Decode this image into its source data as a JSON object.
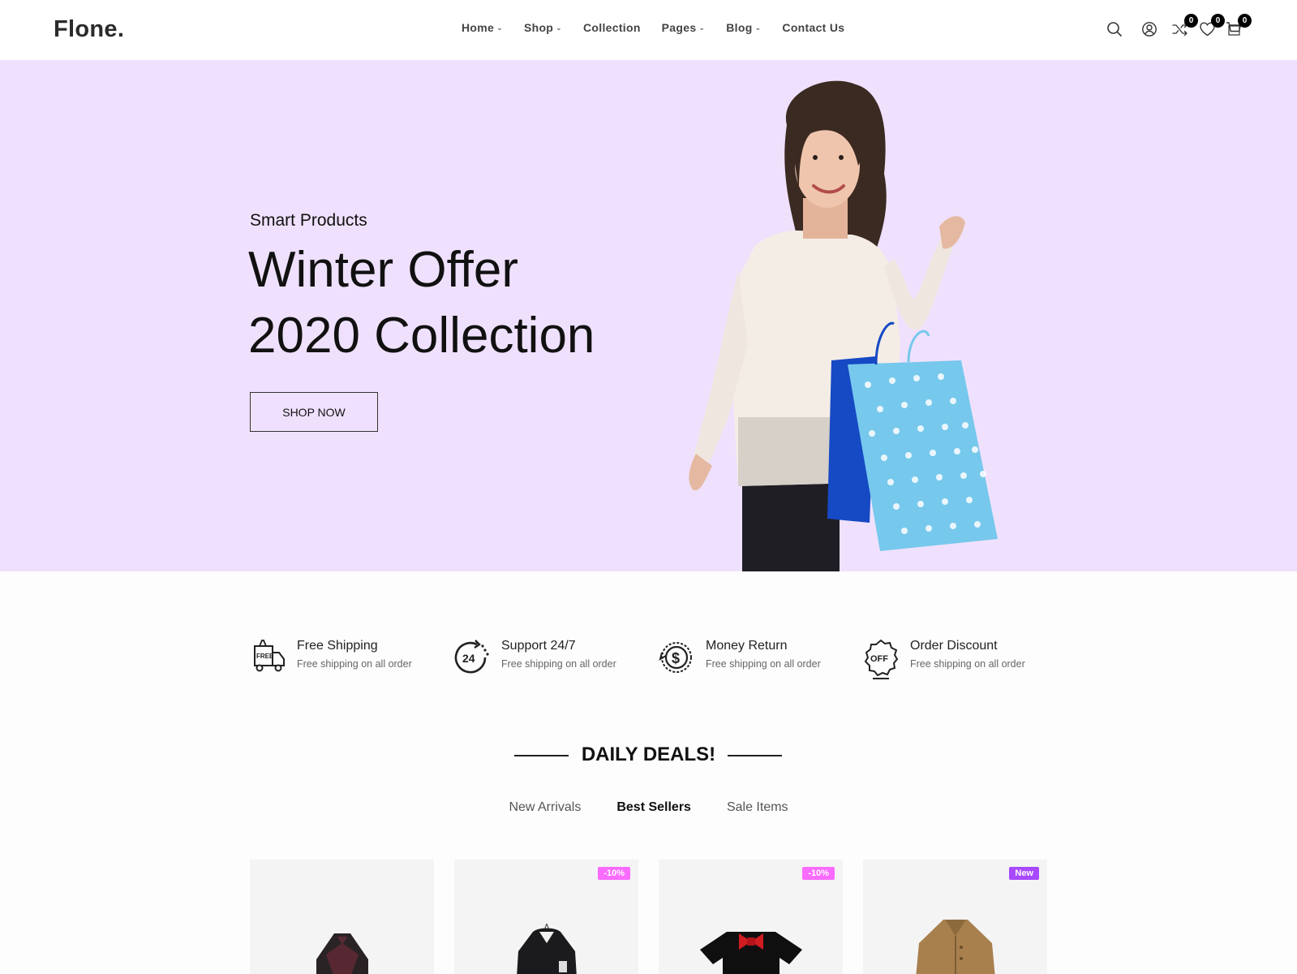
{
  "header": {
    "logo": "Flone.",
    "nav": [
      {
        "label": "Home",
        "has_dropdown": true
      },
      {
        "label": "Shop",
        "has_dropdown": true
      },
      {
        "label": "Collection",
        "has_dropdown": false
      },
      {
        "label": "Pages",
        "has_dropdown": true
      },
      {
        "label": "Blog",
        "has_dropdown": true
      },
      {
        "label": "Contact Us",
        "has_dropdown": false
      }
    ],
    "icons": [
      "search-icon",
      "user-icon",
      "compare-icon",
      "wishlist-icon",
      "cart-icon"
    ],
    "compare_count": "0",
    "wishlist_count": "0",
    "cart_count": "0"
  },
  "hero": {
    "subtitle": "Smart Products",
    "title_line1": "Winter Offer",
    "title_line2": "2020 Collection",
    "button": "SHOP NOW",
    "background": "#efe1fd"
  },
  "features": [
    {
      "icon": "free-shipping-truck-icon",
      "title": "Free Shipping",
      "desc": "Free shipping on all order"
    },
    {
      "icon": "support-24-icon",
      "title": "Support 24/7",
      "desc": "Free shipping on all order"
    },
    {
      "icon": "money-return-icon",
      "title": "Money Return",
      "desc": "Free shipping on all order"
    },
    {
      "icon": "order-discount-icon",
      "title": "Order Discount",
      "desc": "Free shipping on all order"
    }
  ],
  "deals": {
    "title": "DAILY DEALS!",
    "tabs": [
      "New Arrivals",
      "Best Sellers",
      "Sale Items"
    ],
    "active_tab": "Best Sellers"
  },
  "products": [
    {
      "name": "knit-poncho",
      "tag": ""
    },
    {
      "name": "hooded-jacket",
      "tag": "-10%"
    },
    {
      "name": "kids-shirt-bowtie",
      "tag": "-10%"
    },
    {
      "name": "trench-coat",
      "tag": "New"
    }
  ],
  "colors": {
    "sale_tag": "#fa6bff",
    "new_tag": "#a749ff"
  }
}
